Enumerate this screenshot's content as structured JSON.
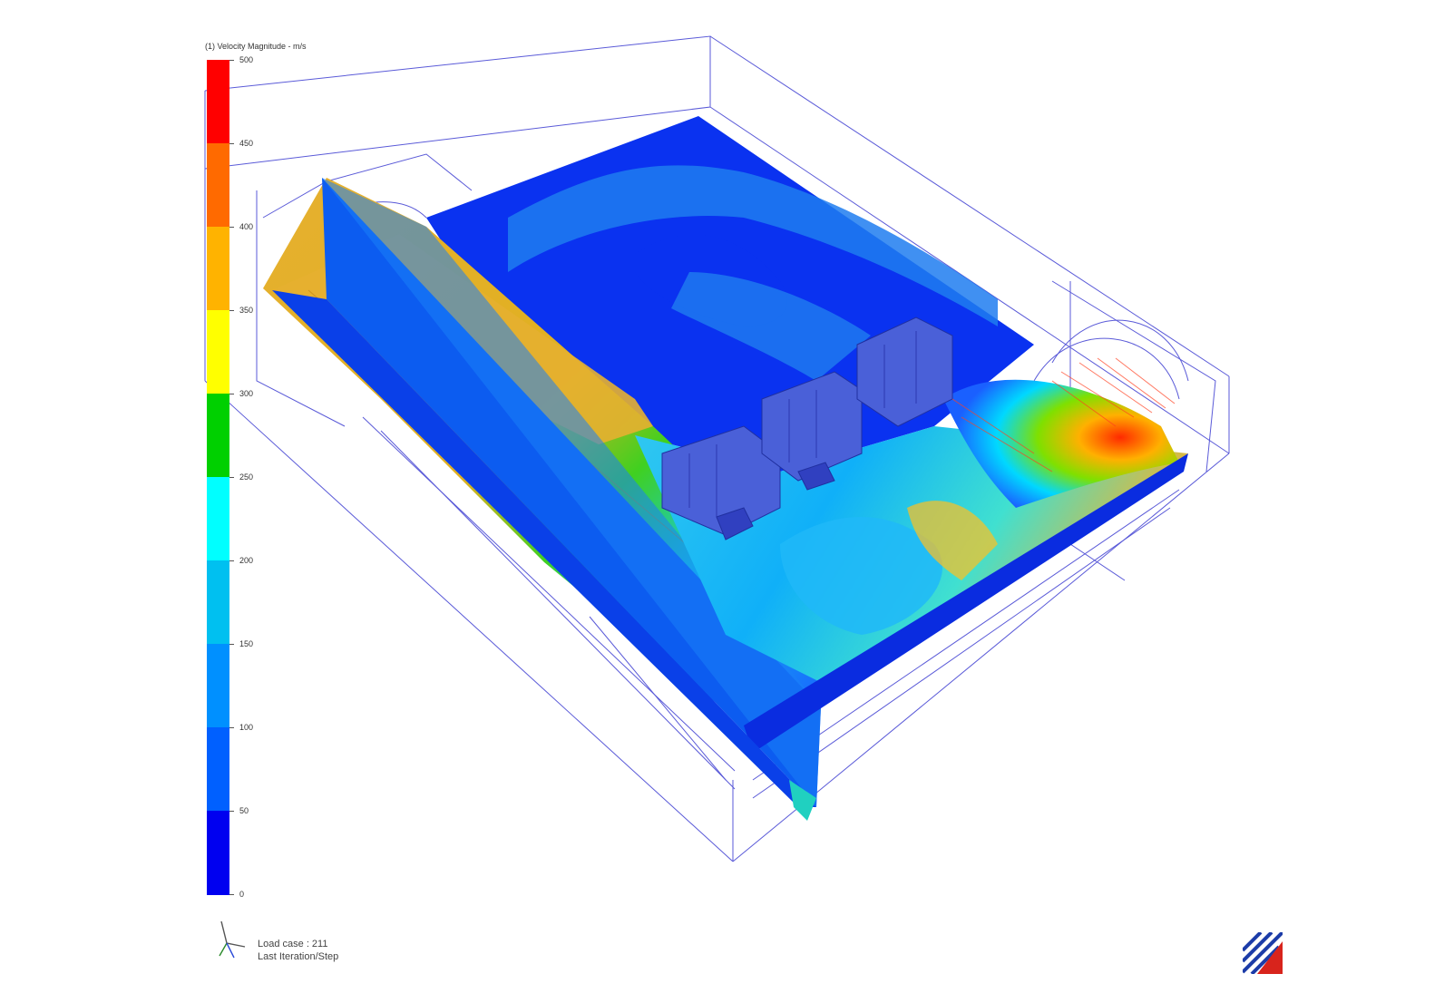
{
  "legend": {
    "title": "(1) Velocity Magnitude - m/s",
    "ticks": [
      "500",
      "450",
      "400",
      "350",
      "300",
      "250",
      "200",
      "150",
      "100",
      "50",
      "0"
    ],
    "band_colors": [
      "#ff0000",
      "#ff6a00",
      "#ffb300",
      "#ffff00",
      "#00d000",
      "#00ffff",
      "#00c0f0",
      "#0090ff",
      "#0060ff",
      "#0000f0"
    ]
  },
  "status": {
    "load_case": "Load case : 211",
    "iteration": "Last Iteration/Step"
  },
  "icons": {
    "triad": "axis-triad-icon",
    "logo": "company-logo-icon"
  }
}
